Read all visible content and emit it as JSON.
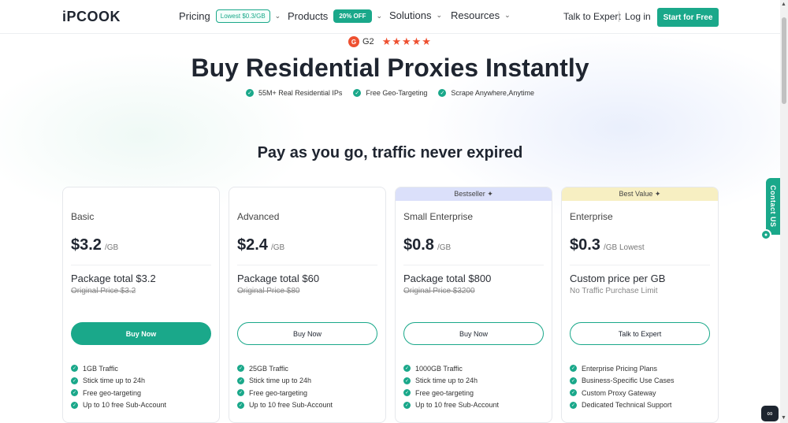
{
  "header": {
    "logo": "iPCOOK",
    "nav": [
      {
        "label": "Pricing",
        "tag": "Lowest $0.3/GB"
      },
      {
        "label": "Products",
        "tag": "20% OFF"
      },
      {
        "label": "Solutions"
      },
      {
        "label": "Resources"
      }
    ],
    "talk_label": "Talk to Expert",
    "login_label": "Log in",
    "start_label": "Start for Free"
  },
  "hero": {
    "g2_badge": "G",
    "g2_label": "G2",
    "stars": "★★★★★",
    "title": "Buy Residential Proxies Instantly",
    "features": [
      "55M+ Real Residential IPs",
      "Free Geo-Targeting",
      "Scrape Anywhere,Anytime"
    ],
    "subtitle": "Pay as you go, traffic never expired"
  },
  "cards": [
    {
      "name": "Basic",
      "price": "$3.2",
      "unit": "/GB",
      "total": "Package total $3.2",
      "original": "Original Price $3.2",
      "button": "Buy Now",
      "features": [
        "1GB Traffic",
        "Stick time up to 24h",
        "Free geo-targeting",
        "Up to 10 free Sub-Account"
      ]
    },
    {
      "name": "Advanced",
      "price": "$2.4",
      "unit": "/GB",
      "total": "Package total $60",
      "original": "Original Price $80",
      "button": "Buy Now",
      "features": [
        "25GB Traffic",
        "Stick time up to 24h",
        "Free geo-targeting",
        "Up to 10 free Sub-Account"
      ]
    },
    {
      "banner": "Bestseller ✦",
      "name": "Small Enterprise",
      "price": "$0.8",
      "unit": "/GB",
      "total": "Package total $800",
      "original": "Original Price $3200",
      "button": "Buy Now",
      "features": [
        "1000GB Traffic",
        "Stick time up to 24h",
        "Free geo-targeting",
        "Up to 10 free Sub-Account"
      ]
    },
    {
      "banner": "Best Value ✦",
      "name": "Enterprise",
      "price": "$0.3",
      "unit": "/GB Lowest",
      "total": "Custom price per GB",
      "original": "No Traffic Purchase Limit",
      "button": "Talk to Expert",
      "features": [
        "Enterprise Pricing Plans",
        "Business-Specific Use Cases",
        "Custom Proxy Gateway",
        "Dedicated Technical Support"
      ]
    }
  ],
  "widgets": {
    "contact_label": "Contact US"
  },
  "colors": {
    "accent": "#1aa88a",
    "bestseller_banner": "#dbe0fa",
    "best_value_banner": "#f7efc2",
    "stars": "#ee5030"
  },
  "icons": {
    "check": "check-circle-icon",
    "chevron": "chevron-down-icon",
    "sparkle": "sparkle-icon",
    "chat": "chat-icon"
  }
}
